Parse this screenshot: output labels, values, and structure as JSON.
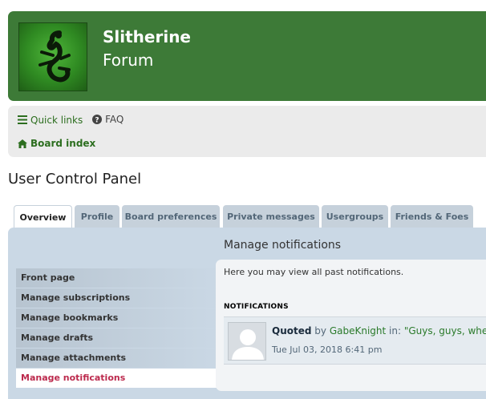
{
  "site": {
    "title": "Slitherine",
    "subtitle": "Forum"
  },
  "nav": {
    "quick_links": "Quick links",
    "faq": "FAQ",
    "board_index": "Board index"
  },
  "page_title": "User Control Panel",
  "tabs": [
    {
      "label": "Overview",
      "active": true
    },
    {
      "label": "Profile"
    },
    {
      "label": "Board preferences"
    },
    {
      "label": "Private messages"
    },
    {
      "label": "Usergroups"
    },
    {
      "label": "Friends & Foes"
    }
  ],
  "section_title": "Manage notifications",
  "menu": [
    {
      "label": "Front page"
    },
    {
      "label": "Manage subscriptions"
    },
    {
      "label": "Manage bookmarks"
    },
    {
      "label": "Manage drafts"
    },
    {
      "label": "Manage attachments"
    },
    {
      "label": "Manage notifications",
      "active": true
    }
  ],
  "content": {
    "description": "Here you may view all past notifications.",
    "notifications_header": "NOTIFICATIONS",
    "notification": {
      "verb": "Quoted",
      "by": "by",
      "user": "GabeKnight",
      "in": "in:",
      "topic": "\"Guys, guys, where",
      "time": "Tue Jul 03, 2018 6:41 pm"
    }
  },
  "colors": {
    "header_bg": "#3d7a37",
    "panel_bg": "#cad8e5",
    "active_menu": "#bc2a4d"
  }
}
